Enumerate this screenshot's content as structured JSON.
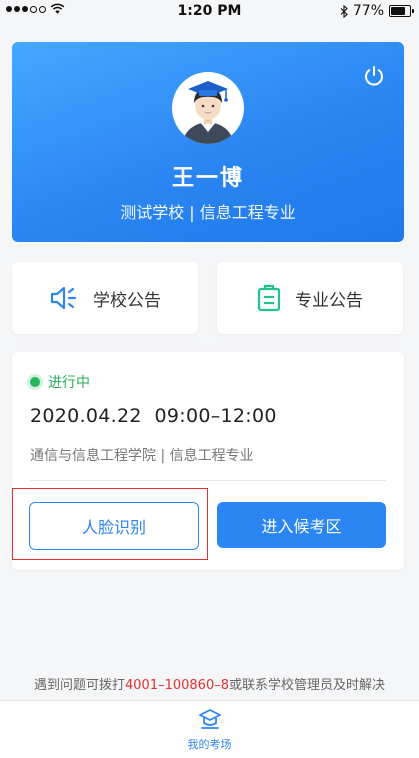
{
  "status_bar": {
    "time": "1:20 PM",
    "battery": "77%",
    "battery_level": 0.77
  },
  "profile": {
    "name": "王一博",
    "school_major": "测试学校 | 信息工程专业",
    "power_icon": "power-icon",
    "avatar_icon": "graduate-avatar-icon"
  },
  "notices": {
    "school": {
      "label": "学校公告",
      "icon": "speaker-icon"
    },
    "major": {
      "label": "专业公告",
      "icon": "clipboard-icon"
    }
  },
  "exam": {
    "status": "进行中",
    "datetime": "2020.04.22  09:00–12:00",
    "department": "通信与信息工程学院 | 信息工程专业",
    "face_button": "人脸识别",
    "enter_button": "进入候考区"
  },
  "help": {
    "prefix": "遇到问题可拨打",
    "phone": "4001–100860–8",
    "suffix": "或联系学校管理员及时解决"
  },
  "tabbar": {
    "my_exam": "我的考场",
    "icon": "exam-hat-icon"
  },
  "colors": {
    "accent": "#2b86f3",
    "status_green": "#27b15a",
    "highlight_red": "#e53030"
  }
}
